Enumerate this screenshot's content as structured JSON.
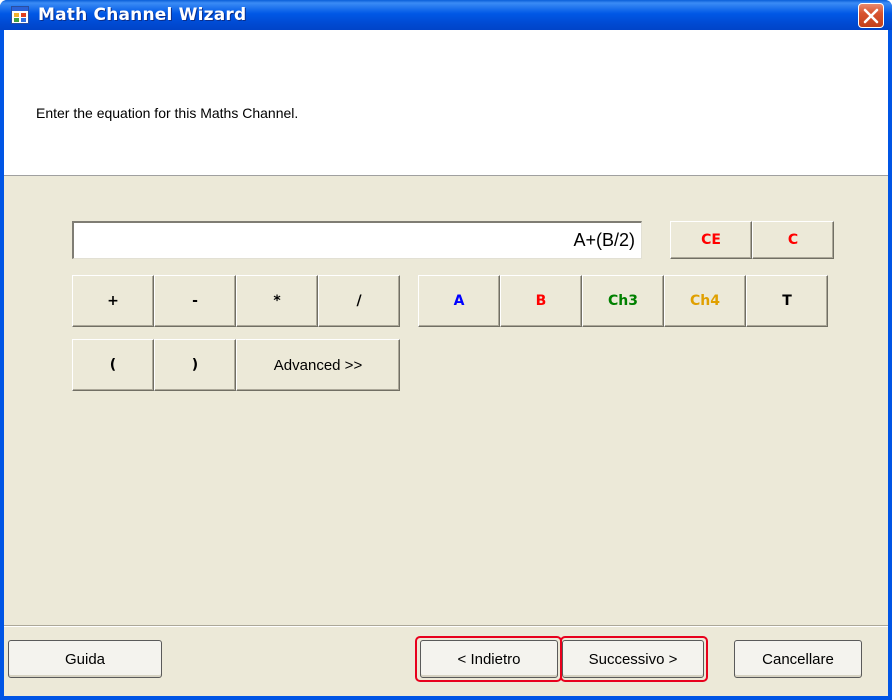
{
  "window": {
    "title": "Math Channel Wizard"
  },
  "header": {
    "instruction": "Enter the equation for this Maths Channel."
  },
  "equation": {
    "value": "A+(B/2)"
  },
  "clear_buttons": {
    "ce": "CE",
    "c": "C"
  },
  "operators": [
    "+",
    "-",
    "*",
    "/"
  ],
  "channels": [
    {
      "label": "A",
      "color": "#0000ff"
    },
    {
      "label": "B",
      "color": "#ff0000"
    },
    {
      "label": "Ch3",
      "color": "#008000"
    },
    {
      "label": "Ch4",
      "color": "#e0a000"
    },
    {
      "label": "T",
      "color": "#000000"
    }
  ],
  "parens": {
    "open": "(",
    "close": ")"
  },
  "advanced_label": "Advanced >>",
  "footer": {
    "help": "Guida",
    "back": "< Indietro",
    "next": "Successivo >",
    "cancel": "Cancellare"
  },
  "colors": {
    "title_bar": "#0054e3",
    "dialog_bg": "#ece9d8",
    "clear_text": "#ff0000",
    "highlight": "#e8001c"
  }
}
